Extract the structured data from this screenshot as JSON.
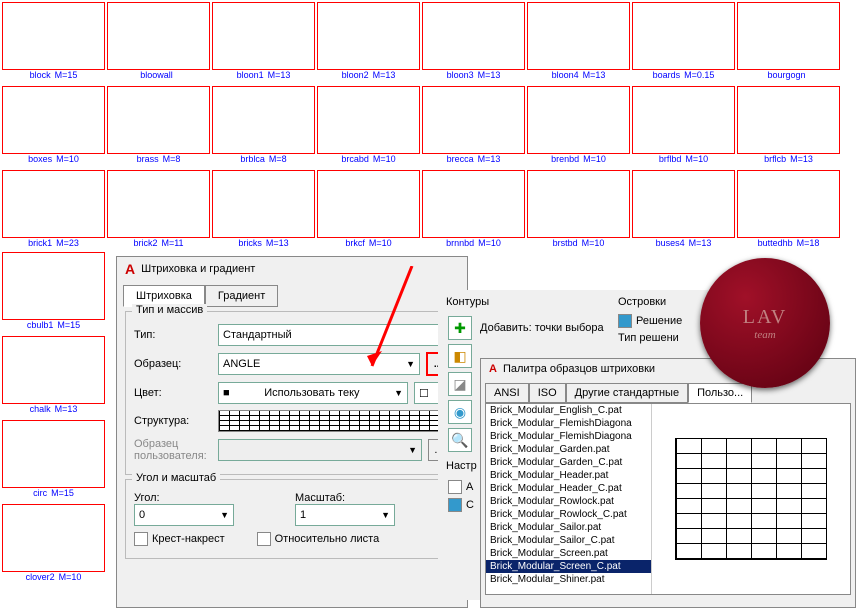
{
  "swatches_top": [
    {
      "name": "block",
      "m": "M=15"
    },
    {
      "name": "bloowall",
      "m": ""
    },
    {
      "name": "bloon1",
      "m": "M=13"
    },
    {
      "name": "bloon2",
      "m": "M=13"
    },
    {
      "name": "bloon3",
      "m": "M=13"
    },
    {
      "name": "bloon4",
      "m": "M=13"
    },
    {
      "name": "boards",
      "m": "M=0.15"
    },
    {
      "name": "bourgogn",
      "m": ""
    },
    {
      "name": "boxes",
      "m": "M=10"
    },
    {
      "name": "brass",
      "m": "M=8"
    },
    {
      "name": "brblca",
      "m": "M=8"
    },
    {
      "name": "brcabd",
      "m": "M=10"
    },
    {
      "name": "brecca",
      "m": "M=13"
    },
    {
      "name": "brenbd",
      "m": "M=10"
    },
    {
      "name": "brflbd",
      "m": "M=10"
    },
    {
      "name": "brflcb",
      "m": "M=13"
    },
    {
      "name": "brick1",
      "m": "M=23"
    },
    {
      "name": "brick2",
      "m": "M=11"
    },
    {
      "name": "bricks",
      "m": "M=13"
    },
    {
      "name": "brkcf",
      "m": "M=10"
    },
    {
      "name": "brnnbd",
      "m": "M=10"
    },
    {
      "name": "brstbd",
      "m": "M=10"
    },
    {
      "name": "buses4",
      "m": "M=13"
    },
    {
      "name": "buttedhb",
      "m": "M=18"
    }
  ],
  "swatches_left": [
    {
      "name": "cbulb1",
      "m": "M=15"
    },
    {
      "name": "chalk",
      "m": "M=13"
    },
    {
      "name": "circ",
      "m": "M=15"
    },
    {
      "name": "clover2",
      "m": "M=10"
    }
  ],
  "dialog1": {
    "title": "Штриховка и градиент",
    "tabs": [
      "Штриховка",
      "Градиент"
    ],
    "group_type": "Тип и массив",
    "type_label": "Тип:",
    "type_value": "Стандартный",
    "pattern_label": "Образец:",
    "pattern_value": "ANGLE",
    "color_label": "Цвет:",
    "color_value": "Использовать теку",
    "struct_label": "Структура:",
    "user_pattern_label": "Образец пользователя:",
    "group_angle": "Угол и масштаб",
    "angle_label": "Угол:",
    "angle_value": "0",
    "scale_label": "Масштаб:",
    "scale_value": "1",
    "chk1": "Крест-накрест",
    "chk2": "Относительно листа"
  },
  "panel2": {
    "boundaries": "Контуры",
    "add_points": "Добавить: точки выбора",
    "islands": "Островки",
    "resolve": "Решение",
    "resolve_type": "Тип решени",
    "settings": "Настр",
    "chk_a": "А",
    "chk_c": "С"
  },
  "dialog2": {
    "title": "Палитра образцов штриховки",
    "tabs": [
      "ANSI",
      "ISO",
      "Другие стандартные",
      "Пользо..."
    ],
    "list": [
      "Brick_Modular_English_C.pat",
      "Brick_Modular_FlemishDiagona",
      "Brick_Modular_FlemishDiagona",
      "Brick_Modular_Garden.pat",
      "Brick_Modular_Garden_C.pat",
      "Brick_Modular_Header.pat",
      "Brick_Modular_Header_C.pat",
      "Brick_Modular_Rowlock.pat",
      "Brick_Modular_Rowlock_C.pat",
      "Brick_Modular_Sailor.pat",
      "Brick_Modular_Sailor_C.pat",
      "Brick_Modular_Screen.pat",
      "Brick_Modular_Screen_C.pat",
      "Brick_Modular_Shiner.pat"
    ],
    "selected_index": 12
  },
  "seal": {
    "line1": "LAV",
    "line2": "team"
  }
}
